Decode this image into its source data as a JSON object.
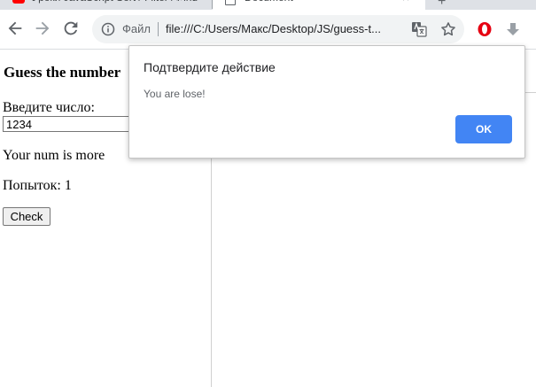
{
  "browser": {
    "tabs": [
      {
        "title": "Уроки JavaScript Sort / Filter / Find",
        "close": "×"
      },
      {
        "title": "Document",
        "close": "×"
      }
    ],
    "new_tab": "+",
    "omnibox": {
      "scheme_label": "Файл",
      "url": "file:///C:/Users/Макс/Desktop/JS/guess-t..."
    }
  },
  "page": {
    "heading": "Guess the number",
    "input_label": "Введите число:",
    "input_value": "1234",
    "result_text": "Your num is more",
    "tries_text": "Попыток: 1",
    "check_button": "Check"
  },
  "dialog": {
    "title": "Подтвердите действие",
    "message": "You are lose!",
    "ok_label": "OK"
  },
  "colors": {
    "accent": "#4285f4",
    "tabstrip": "#dee1e6",
    "omnibox_bg": "#f1f3f4"
  }
}
